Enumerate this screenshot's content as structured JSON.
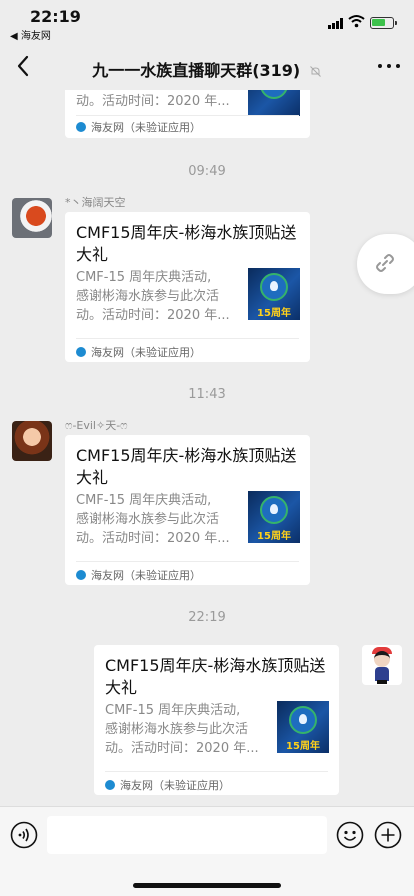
{
  "status_bar": {
    "time": "22:19",
    "back_label": "◀ 海友网"
  },
  "nav": {
    "title": "九一一水族直播聊天群(319)"
  },
  "timestamps": [
    "09:49",
    "11:43",
    "22:19"
  ],
  "messages": [
    {
      "sender": "",
      "card": {
        "title": "",
        "desc_line1": "",
        "desc_line2": "动。活动时间：2020 年...",
        "source": "海友网（未验证应用）"
      }
    },
    {
      "sender": "*丶海阔天空",
      "card": {
        "title": "CMF15周年庆-彬海水族顶贴送大礼",
        "desc_line1": "CMF-15 周年庆典活动,",
        "desc_line2": "感谢彬海水族参与此次活",
        "desc_line3": "动。活动时间：2020 年...",
        "source": "海友网（未验证应用）",
        "thumb_text": "15周年"
      }
    },
    {
      "sender": "ෆ-Evil✧天-ෆ",
      "card": {
        "title": "CMF15周年庆-彬海水族顶贴送大礼",
        "desc_line1": "CMF-15 周年庆典活动,",
        "desc_line2": "感谢彬海水族参与此次活",
        "desc_line3": "动。活动时间：2020 年...",
        "source": "海友网（未验证应用）",
        "thumb_text": "15周年"
      }
    },
    {
      "sender": "",
      "card": {
        "title": "CMF15周年庆-彬海水族顶贴送大礼",
        "desc_line1": "CMF-15 周年庆典活动,",
        "desc_line2": "感谢彬海水族参与此次活",
        "desc_line3": "动。活动时间：2020 年...",
        "source": "海友网（未验证应用）",
        "thumb_text": "15周年"
      }
    }
  ],
  "input": {
    "value": "",
    "placeholder": ""
  },
  "icons": {
    "nav_back": "chevron-left-icon",
    "mute": "bell-off-icon",
    "more": "more-icon",
    "share": "link-icon",
    "voice": "voice-icon",
    "emoji": "emoji-icon",
    "plus": "plus-icon",
    "source": "haiyou-app-icon"
  },
  "colors": {
    "background": "#ededed",
    "card": "#ffffff",
    "timestamp": "#9a9a9a",
    "battery": "#3dc24b"
  }
}
